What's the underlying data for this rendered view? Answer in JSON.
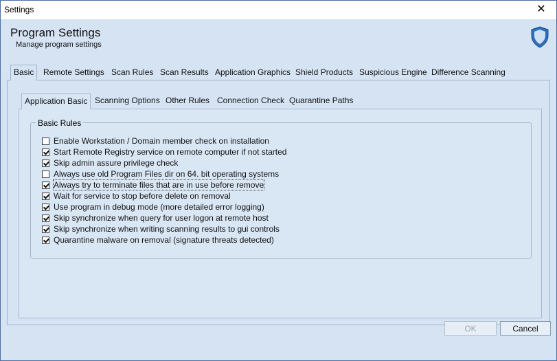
{
  "window": {
    "title": "Settings",
    "close_glyph": "✕"
  },
  "header": {
    "title": "Program Settings",
    "subtitle": "Manage program settings",
    "icon": "shield-icon"
  },
  "tabs_outer": [
    {
      "label": "Basic"
    },
    {
      "label": "Remote Settings"
    },
    {
      "label": "Scan Rules"
    },
    {
      "label": "Scan Results"
    },
    {
      "label": "Application Graphics"
    },
    {
      "label": "Shield Products"
    },
    {
      "label": "Suspicious Engine"
    },
    {
      "label": "Difference Scanning"
    }
  ],
  "tabs_inner": [
    {
      "label": "Application Basic"
    },
    {
      "label": "Scanning Options"
    },
    {
      "label": "Other Rules"
    },
    {
      "label": "Connection Check"
    },
    {
      "label": "Quarantine Paths"
    }
  ],
  "group": {
    "title": "Basic Rules",
    "items": [
      {
        "label": "Enable Workstation / Domain member check on installation",
        "checked": false
      },
      {
        "label": "Start Remote Registry service on remote computer if not started",
        "checked": true
      },
      {
        "label": "Skip admin assure privilege check",
        "checked": true
      },
      {
        "label": "Always use old Program Files dir on 64. bit operating systems",
        "checked": false
      },
      {
        "label": "Always try to terminate files that are in use before remove",
        "checked": true
      },
      {
        "label": "Wait for service to stop before delete on removal",
        "checked": true
      },
      {
        "label": "Use program in debug mode (more detailed error logging)",
        "checked": true
      },
      {
        "label": "Skip synchronize when query for user logon at remote host",
        "checked": true
      },
      {
        "label": "Skip synchronize when writing scanning results to gui controls",
        "checked": true
      },
      {
        "label": "Quarantine malware on removal (signature threats detected)",
        "checked": true
      }
    ]
  },
  "buttons": {
    "ok": "OK",
    "cancel": "Cancel"
  },
  "colors": {
    "accent": "#4a6fa5",
    "client_bg": "#d5e3f3"
  }
}
